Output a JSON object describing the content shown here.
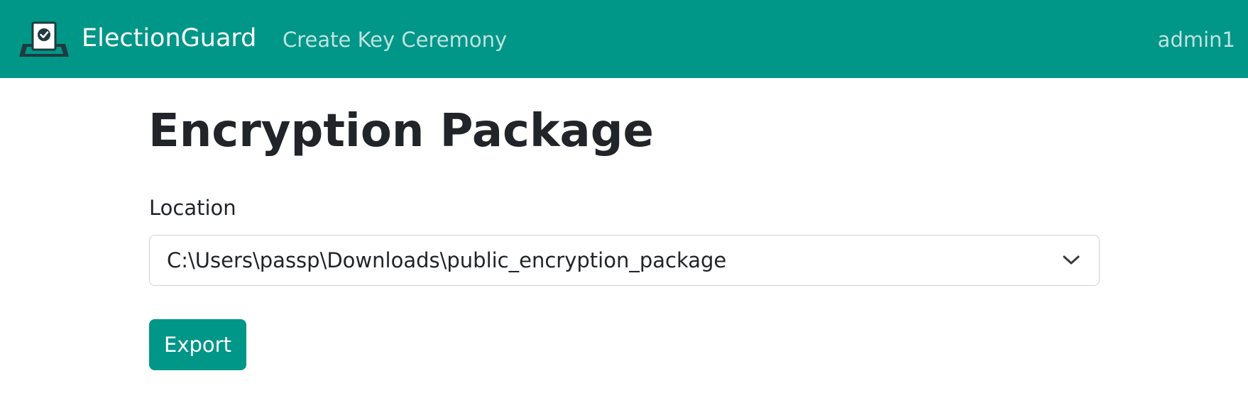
{
  "navbar": {
    "brand_name": "ElectionGuard",
    "brand_icon": "ballot-box-check-icon",
    "nav_link": "Create Key Ceremony",
    "user": "admin1",
    "background_color": "#009688"
  },
  "main": {
    "title": "Encryption Package",
    "location_label": "Location",
    "location_value": "C:\\Users\\passp\\Downloads\\public_encryption_package",
    "dropdown_icon": "chevron-down-icon",
    "export_label": "Export"
  }
}
